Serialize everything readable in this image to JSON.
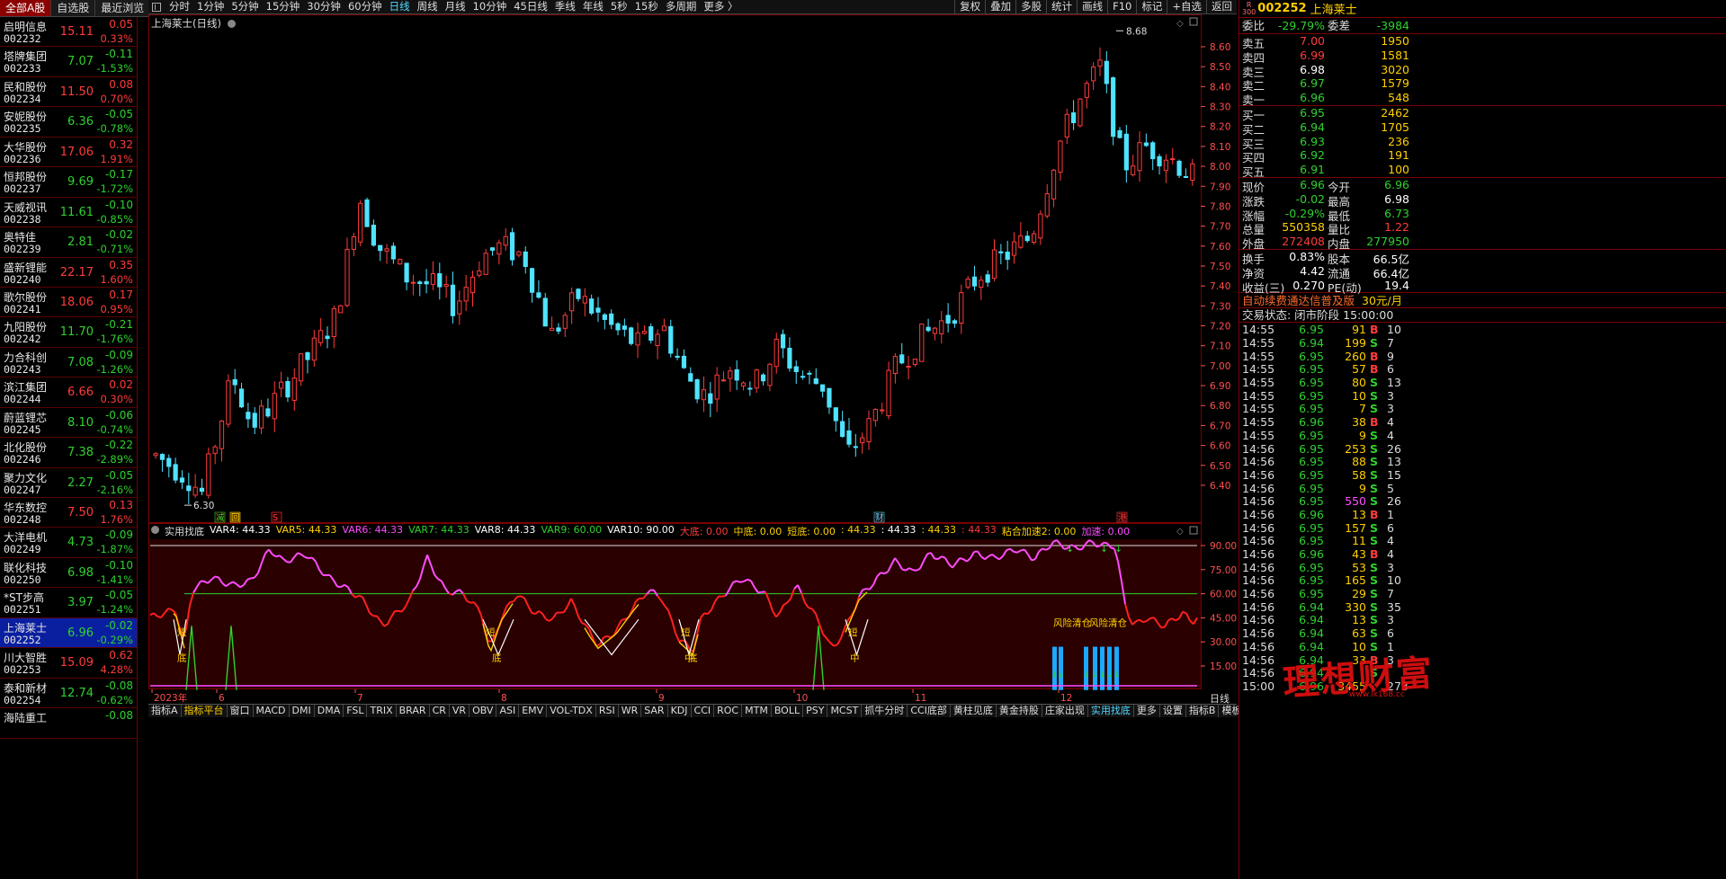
{
  "left_tabs": [
    "全部A股",
    "自选股",
    "最近浏览"
  ],
  "stocks": [
    {
      "name": "启明信息",
      "code": "002232",
      "price": "15.11",
      "chg": "0.05",
      "pct": "0.33%",
      "dir": "up"
    },
    {
      "name": "塔牌集团",
      "code": "002233",
      "price": "7.07",
      "chg": "-0.11",
      "pct": "-1.53%",
      "dir": "dn"
    },
    {
      "name": "民和股份",
      "code": "002234",
      "price": "11.50",
      "chg": "0.08",
      "pct": "0.70%",
      "dir": "up"
    },
    {
      "name": "安妮股份",
      "code": "002235",
      "price": "6.36",
      "chg": "-0.05",
      "pct": "-0.78%",
      "dir": "dn"
    },
    {
      "name": "大华股份",
      "code": "002236",
      "price": "17.06",
      "chg": "0.32",
      "pct": "1.91%",
      "dir": "up"
    },
    {
      "name": "恒邦股份",
      "code": "002237",
      "price": "9.69",
      "chg": "-0.17",
      "pct": "-1.72%",
      "dir": "dn"
    },
    {
      "name": "天威视讯",
      "code": "002238",
      "price": "11.61",
      "chg": "-0.10",
      "pct": "-0.85%",
      "dir": "dn"
    },
    {
      "name": "奥特佳",
      "code": "002239",
      "price": "2.81",
      "chg": "-0.02",
      "pct": "-0.71%",
      "dir": "dn"
    },
    {
      "name": "盛新锂能",
      "code": "002240",
      "price": "22.17",
      "chg": "0.35",
      "pct": "1.60%",
      "dir": "up"
    },
    {
      "name": "歌尔股份",
      "code": "002241",
      "price": "18.06",
      "chg": "0.17",
      "pct": "0.95%",
      "dir": "up"
    },
    {
      "name": "九阳股份",
      "code": "002242",
      "price": "11.70",
      "chg": "-0.21",
      "pct": "-1.76%",
      "dir": "dn"
    },
    {
      "name": "力合科创",
      "code": "002243",
      "price": "7.08",
      "chg": "-0.09",
      "pct": "-1.26%",
      "dir": "dn"
    },
    {
      "name": "滨江集团",
      "code": "002244",
      "price": "6.66",
      "chg": "0.02",
      "pct": "0.30%",
      "dir": "up"
    },
    {
      "name": "蔚蓝锂芯",
      "code": "002245",
      "price": "8.10",
      "chg": "-0.06",
      "pct": "-0.74%",
      "dir": "dn"
    },
    {
      "name": "北化股份",
      "code": "002246",
      "price": "7.38",
      "chg": "-0.22",
      "pct": "-2.89%",
      "dir": "dn"
    },
    {
      "name": "聚力文化",
      "code": "002247",
      "price": "2.27",
      "chg": "-0.05",
      "pct": "-2.16%",
      "dir": "dn"
    },
    {
      "name": "华东数控",
      "code": "002248",
      "price": "7.50",
      "chg": "0.13",
      "pct": "1.76%",
      "dir": "up"
    },
    {
      "name": "大洋电机",
      "code": "002249",
      "price": "4.73",
      "chg": "-0.09",
      "pct": "-1.87%",
      "dir": "dn"
    },
    {
      "name": "联化科技",
      "code": "002250",
      "price": "6.98",
      "chg": "-0.10",
      "pct": "-1.41%",
      "dir": "dn"
    },
    {
      "name": "*ST步高",
      "code": "002251",
      "price": "3.97",
      "chg": "-0.05",
      "pct": "-1.24%",
      "dir": "dn"
    },
    {
      "name": "上海莱士",
      "code": "002252",
      "price": "6.96",
      "chg": "-0.02",
      "pct": "-0.29%",
      "dir": "dn",
      "selected": true
    },
    {
      "name": "川大智胜",
      "code": "002253",
      "price": "15.09",
      "chg": "0.62",
      "pct": "4.28%",
      "dir": "up"
    },
    {
      "name": "泰和新材",
      "code": "002254",
      "price": "12.74",
      "chg": "-0.08",
      "pct": "-0.62%",
      "dir": "dn"
    },
    {
      "name": "海陆重工",
      "code": "",
      "price": "",
      "chg": "-0.08",
      "pct": "",
      "dir": "dn"
    }
  ],
  "period_bar": {
    "items": [
      "分时",
      "1分钟",
      "5分钟",
      "15分钟",
      "30分钟",
      "60分钟",
      "日线",
      "周线",
      "月线",
      "10分钟",
      "45日线",
      "季线",
      "年线",
      "5秒",
      "15秒",
      "多周期",
      "更多 〉"
    ],
    "active": "日线",
    "right_items": [
      "复权",
      "叠加",
      "多股",
      "统计",
      "画线",
      "F10",
      "标记",
      "+自选",
      "返回"
    ]
  },
  "chart": {
    "title": "上海莱士(日线)",
    "y_axis_ticks": [
      "8.60",
      "8.50",
      "8.40",
      "8.30",
      "8.20",
      "8.10",
      "8.00",
      "7.90",
      "7.80",
      "7.70",
      "7.60",
      "7.50",
      "7.40",
      "7.30",
      "7.20",
      "7.10",
      "7.00",
      "6.90",
      "6.80",
      "6.70",
      "6.60",
      "6.50",
      "6.40"
    ],
    "high_label": "8.68",
    "low_label": "6.30",
    "x_labels": [
      "2023年",
      "6",
      "7",
      "8",
      "9",
      "10",
      "11",
      "12"
    ],
    "event_markers": [
      "减",
      "回",
      "S",
      "财",
      "港"
    ],
    "colors": {
      "up": "#ff3b3b",
      "down": "#4fe3ff",
      "grid": "#5a0000",
      "axis": "#ff5050"
    }
  },
  "indicator": {
    "name": "实用找底",
    "params": [
      {
        "text": "VAR4: 44.33",
        "color": "#ffffff"
      },
      {
        "text": "VAR5: 44.33",
        "color": "#ffd000"
      },
      {
        "text": "VAR6: 44.33",
        "color": "#ff4cff"
      },
      {
        "text": "VAR7: 44.33",
        "color": "#2fd12f"
      },
      {
        "text": "VAR8: 44.33",
        "color": "#ffffff"
      },
      {
        "text": "VAR9: 60.00",
        "color": "#2fd12f"
      },
      {
        "text": "VAR10: 90.00",
        "color": "#ffffff"
      },
      {
        "text": "大底: 0.00",
        "color": "#ff3b3b"
      },
      {
        "text": "中底: 0.00",
        "color": "#ffd000"
      },
      {
        "text": "短底: 0.00",
        "color": "#ffd000"
      },
      {
        "text": ": 44.33",
        "color": "#ffd000"
      },
      {
        "text": ": 44.33",
        "color": "#ffffff"
      },
      {
        "text": ": 44.33",
        "color": "#ffd000"
      },
      {
        "text": ": 44.33",
        "color": "#ff3b3b"
      },
      {
        "text": "粘合加速2: 0.00",
        "color": "#ffd000"
      },
      {
        "text": "加速: 0.00",
        "color": "#ff4cff"
      }
    ],
    "y_axis_ticks": [
      "90.00",
      "75.00",
      "60.00",
      "45.00",
      "30.00",
      "15.00"
    ],
    "annotations": {
      "short": "短",
      "bottom": "底",
      "mid": "中",
      "risk_exit": "风险清仓",
      "risk_clear": "风险清仓"
    }
  },
  "bottom_tabs": [
    "指标A",
    "指标平台",
    "窗口",
    "MACD",
    "DMI",
    "DMA",
    "FSL",
    "TRIX",
    "BRAR",
    "CR",
    "VR",
    "OBV",
    "ASI",
    "EMV",
    "VOL-TDX",
    "RSI",
    "WR",
    "SAR",
    "KDJ",
    "CCI",
    "ROC",
    "MTM",
    "BOLL",
    "PSY",
    "MCST",
    "抓牛分时",
    "CCI底部",
    "黄柱见底",
    "黄金持股",
    "庄家出现",
    "实用找底",
    "更多",
    "设置"
  ],
  "bottom_right_tabs": [
    "指标B",
    "模板",
    "+",
    "−"
  ],
  "day_line_label": "日线",
  "right_panel": {
    "badge_top": "R",
    "badge_bottom": "300",
    "code": "002252",
    "name": "上海莱士",
    "ratio": {
      "l1": "委比",
      "v1": "-29.79%",
      "l2": "委差",
      "v2": "-3984"
    },
    "asks": [
      {
        "label": "卖五",
        "price": "7.00",
        "vol": "1950",
        "pc": "red"
      },
      {
        "label": "卖四",
        "price": "6.99",
        "vol": "1581",
        "pc": "red"
      },
      {
        "label": "卖三",
        "price": "6.98",
        "vol": "3020",
        "pc": "wht"
      },
      {
        "label": "卖二",
        "price": "6.97",
        "vol": "1579",
        "pc": "grn"
      },
      {
        "label": "卖一",
        "price": "6.96",
        "vol": "548",
        "pc": "grn"
      }
    ],
    "bids": [
      {
        "label": "买一",
        "price": "6.95",
        "vol": "2462",
        "pc": "grn"
      },
      {
        "label": "买二",
        "price": "6.94",
        "vol": "1705",
        "pc": "grn"
      },
      {
        "label": "买三",
        "price": "6.93",
        "vol": "236",
        "pc": "grn"
      },
      {
        "label": "买四",
        "price": "6.92",
        "vol": "191",
        "pc": "grn"
      },
      {
        "label": "买五",
        "price": "6.91",
        "vol": "100",
        "pc": "grn"
      }
    ],
    "stats": [
      {
        "l1": "现价",
        "v1": "6.96",
        "c1": "grn",
        "l2": "今开",
        "v2": "6.96",
        "c2": "grn"
      },
      {
        "l1": "涨跌",
        "v1": "-0.02",
        "c1": "grn",
        "l2": "最高",
        "v2": "6.98",
        "c2": "wht"
      },
      {
        "l1": "涨幅",
        "v1": "-0.29%",
        "c1": "grn",
        "l2": "最低",
        "v2": "6.73",
        "c2": "grn"
      },
      {
        "l1": "总量",
        "v1": "550358",
        "c1": "yel",
        "l2": "量比",
        "v2": "1.22",
        "c2": "red"
      },
      {
        "l1": "外盘",
        "v1": "272408",
        "c1": "red",
        "l2": "内盘",
        "v2": "277950",
        "c2": "grn"
      }
    ],
    "fund": [
      {
        "l1": "换手",
        "v1": "0.83%",
        "c1": "wht",
        "l2": "股本",
        "v2": "66.5亿",
        "c2": "wht"
      },
      {
        "l1": "净资",
        "v1": "4.42",
        "c1": "wht",
        "l2": "流通",
        "v2": "66.4亿",
        "c2": "wht"
      },
      {
        "l1": "收益(三)",
        "v1": "0.270",
        "c1": "wht",
        "l2": "PE(动)",
        "v2": "19.4",
        "c2": "wht"
      }
    ],
    "ad_text": "自动续费通达信普及版",
    "ad_price": "30元/月",
    "trade_status": "交易状态: 闭市阶段 15:00:00",
    "ticks": [
      {
        "t": "14:55",
        "p": "6.95",
        "v": "91",
        "bs": "B",
        "n": "10"
      },
      {
        "t": "14:55",
        "p": "6.94",
        "v": "199",
        "bs": "S",
        "n": "7"
      },
      {
        "t": "14:55",
        "p": "6.95",
        "v": "260",
        "bs": "B",
        "n": "9"
      },
      {
        "t": "14:55",
        "p": "6.95",
        "v": "57",
        "bs": "B",
        "n": "6"
      },
      {
        "t": "14:55",
        "p": "6.95",
        "v": "80",
        "bs": "S",
        "n": "13"
      },
      {
        "t": "14:55",
        "p": "6.95",
        "v": "10",
        "bs": "S",
        "n": "3"
      },
      {
        "t": "14:55",
        "p": "6.95",
        "v": "7",
        "bs": "S",
        "n": "3"
      },
      {
        "t": "14:55",
        "p": "6.96",
        "v": "38",
        "bs": "B",
        "n": "4"
      },
      {
        "t": "14:55",
        "p": "6.95",
        "v": "9",
        "bs": "S",
        "n": "4"
      },
      {
        "t": "14:56",
        "p": "6.95",
        "v": "253",
        "bs": "S",
        "n": "26"
      },
      {
        "t": "14:56",
        "p": "6.95",
        "v": "88",
        "bs": "S",
        "n": "13"
      },
      {
        "t": "14:56",
        "p": "6.95",
        "v": "58",
        "bs": "S",
        "n": "15"
      },
      {
        "t": "14:56",
        "p": "6.95",
        "v": "9",
        "bs": "S",
        "n": "5"
      },
      {
        "t": "14:56",
        "p": "6.95",
        "v": "550",
        "bs": "S",
        "n": "26",
        "vc": "mag"
      },
      {
        "t": "14:56",
        "p": "6.96",
        "v": "13",
        "bs": "B",
        "n": "1"
      },
      {
        "t": "14:56",
        "p": "6.95",
        "v": "157",
        "bs": "S",
        "n": "6"
      },
      {
        "t": "14:56",
        "p": "6.95",
        "v": "11",
        "bs": "S",
        "n": "4"
      },
      {
        "t": "14:56",
        "p": "6.96",
        "v": "43",
        "bs": "B",
        "n": "4"
      },
      {
        "t": "14:56",
        "p": "6.95",
        "v": "53",
        "bs": "S",
        "n": "3"
      },
      {
        "t": "14:56",
        "p": "6.95",
        "v": "165",
        "bs": "S",
        "n": "10"
      },
      {
        "t": "14:56",
        "p": "6.95",
        "v": "29",
        "bs": "S",
        "n": "7"
      },
      {
        "t": "14:56",
        "p": "6.94",
        "v": "330",
        "bs": "S",
        "n": "35"
      },
      {
        "t": "14:56",
        "p": "6.94",
        "v": "13",
        "bs": "S",
        "n": "3"
      },
      {
        "t": "14:56",
        "p": "6.94",
        "v": "63",
        "bs": "S",
        "n": "6"
      },
      {
        "t": "14:56",
        "p": "6.94",
        "v": "10",
        "bs": "S",
        "n": "1"
      },
      {
        "t": "14:56",
        "p": "6.94",
        "v": "33",
        "bs": "B",
        "n": "3"
      },
      {
        "t": "14:56",
        "p": "6.94",
        "v": "",
        "bs": "S",
        "n": ""
      },
      {
        "t": "15:00",
        "p": "6.96",
        "v": "3455",
        "bs": "",
        "n": "273"
      }
    ]
  },
  "watermark": {
    "text": "理想财富",
    "sub": "www.lx168.cc"
  }
}
